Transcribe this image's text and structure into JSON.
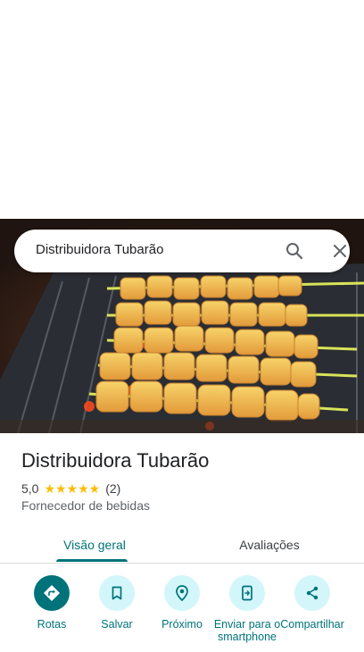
{
  "search": {
    "query": "Distribuidora Tubarão"
  },
  "place": {
    "name": "Distribuidora Tubarão",
    "rating": "5,0",
    "stars": "★★★★★",
    "review_count": "(2)",
    "category": "Fornecedor de bebidas"
  },
  "tabs": [
    {
      "label": "Visão geral",
      "selected": true
    },
    {
      "label": "Avaliações",
      "selected": false
    }
  ],
  "actions": [
    {
      "label": "Rotas",
      "icon": "directions-icon"
    },
    {
      "label": "Salvar",
      "icon": "bookmark-icon"
    },
    {
      "label": "Próximo",
      "icon": "nearby-icon"
    },
    {
      "label": "Enviar para o smartphone",
      "icon": "send-to-phone-icon"
    },
    {
      "label": "Compartilhar",
      "icon": "share-icon"
    }
  ],
  "colors": {
    "accent": "#00737a",
    "action_bg": "#d3f6fb",
    "star": "#fbbc04"
  }
}
